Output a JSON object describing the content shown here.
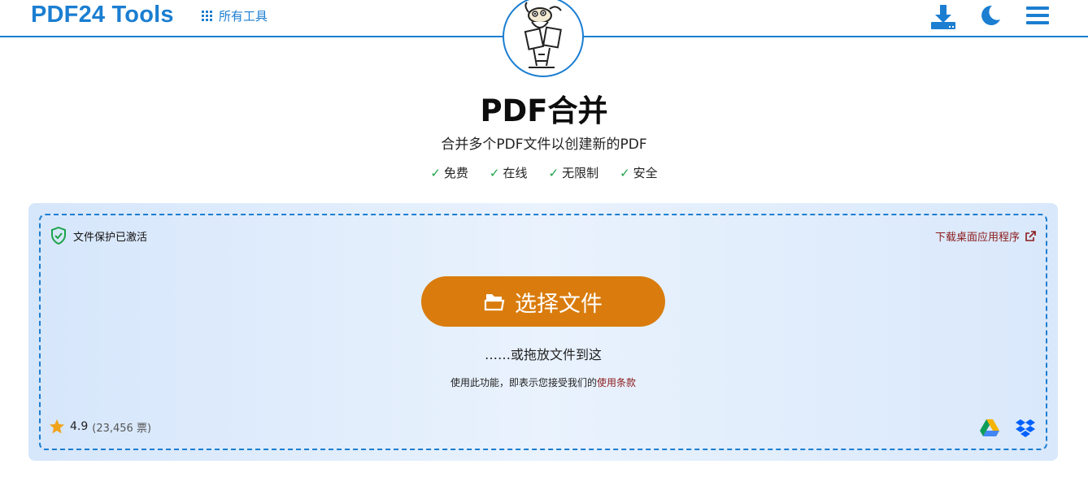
{
  "header": {
    "logo": "PDF24 Tools",
    "all_tools": "所有工具"
  },
  "hero": {
    "title": "PDF合并",
    "subtitle": "合并多个PDF文件以创建新的PDF",
    "features": [
      "免费",
      "在线",
      "无限制",
      "安全"
    ]
  },
  "upload": {
    "protection": "文件保护已激活",
    "desktop_app": "下载桌面应用程序",
    "choose_button": "选择文件",
    "drop_hint": "……或拖放文件到这",
    "terms_prefix": "使用此功能，即表示您接受我们的",
    "terms_link": "使用条款",
    "rating_value": "4.9",
    "rating_votes": "(23,456 票)"
  },
  "colors": {
    "brand": "#1b7ed1",
    "button": "#d97c0d",
    "link": "#8b1a1a",
    "check": "#1ea34a"
  },
  "icons": [
    "grid-icon",
    "download-icon",
    "moon-icon",
    "menu-icon",
    "shield-check-icon",
    "external-link-icon",
    "file-open-icon",
    "star-icon",
    "google-drive-icon",
    "dropbox-icon"
  ]
}
